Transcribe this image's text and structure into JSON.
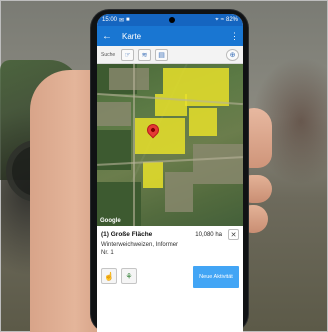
{
  "statusbar": {
    "time": "15:00",
    "battery": "82%"
  },
  "appbar": {
    "title": "Karte",
    "back_icon": "arrow-left-icon",
    "more_icon": "more-vert-icon"
  },
  "toolbar": {
    "search_label": "Suche"
  },
  "map": {
    "attribution": "Google"
  },
  "field": {
    "title": "(1) Große Fläche",
    "area": "10,080 ha",
    "crop": "Winterweichweizen, Informer",
    "number": "Nr. 1"
  },
  "actions": {
    "new_activity": "Neue Aktivität"
  },
  "colors": {
    "primary": "#1976d2",
    "statusbar": "#1565c0",
    "button": "#42a5f5",
    "highlight": "#e7e12a"
  }
}
